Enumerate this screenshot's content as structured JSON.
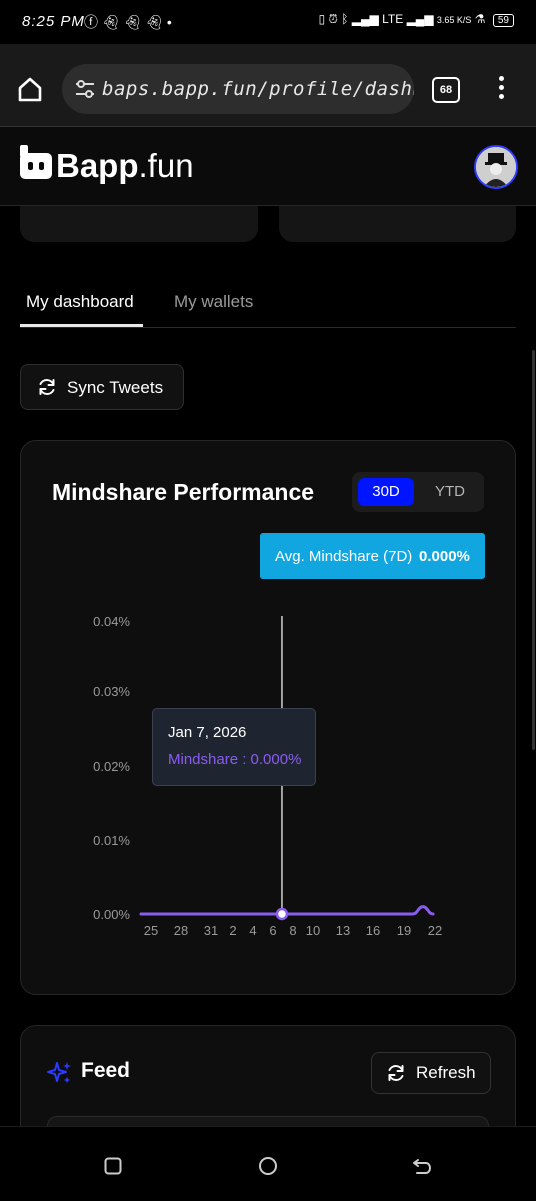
{
  "status_bar": {
    "time": "8:25 PM",
    "left_icons": [
      "facebook-icon",
      "snapchat-icon",
      "snapchat-icon",
      "snapchat-icon",
      "dot-icon"
    ],
    "network": "LTE",
    "speed": "3.65 K/S",
    "battery": "59"
  },
  "browser": {
    "url": "baps.bapp.fun/profile/dashboard",
    "tab_count": "68"
  },
  "site": {
    "logo_bold": "Bapp",
    "logo_rest": ".fun"
  },
  "tabs": [
    {
      "label": "My dashboard",
      "active": true
    },
    {
      "label": "My wallets",
      "active": false
    }
  ],
  "sync_button": {
    "label": "Sync Tweets"
  },
  "mindshare": {
    "title": "Mindshare Performance",
    "range_options": [
      "30D",
      "YTD"
    ],
    "selected_range": "30D",
    "avg_label": "Avg. Mindshare (7D)",
    "avg_value": "0.000%",
    "tooltip": {
      "date": "Jan 7, 2026",
      "text": "Mindshare : 0.000%"
    }
  },
  "chart_data": {
    "type": "line",
    "y_ticks": [
      "0.04%",
      "0.03%",
      "0.02%",
      "0.01%",
      "0.00%"
    ],
    "ylim": [
      0,
      0.04
    ],
    "x_tick_labels": [
      "25",
      "28",
      "31",
      "2",
      "4",
      "6",
      "8",
      "10",
      "13",
      "16",
      "19",
      "22"
    ],
    "series": [
      {
        "color": "#8a5cf0",
        "x": [
          "Dec 24",
          "Dec 25",
          "Dec 26",
          "Dec 27",
          "Dec 28",
          "Dec 29",
          "Dec 30",
          "Dec 31",
          "Jan 1",
          "Jan 2",
          "Jan 3",
          "Jan 4",
          "Jan 5",
          "Jan 6",
          "Jan 7",
          "Jan 8",
          "Jan 9",
          "Jan 10",
          "Jan 11",
          "Jan 12",
          "Jan 13",
          "Jan 14",
          "Jan 15",
          "Jan 16",
          "Jan 17",
          "Jan 18",
          "Jan 19",
          "Jan 20",
          "Jan 21",
          "Jan 22"
        ],
        "values": [
          0,
          0,
          0,
          0,
          0,
          0,
          0,
          0,
          0,
          0,
          0,
          0,
          0,
          0,
          0,
          0,
          0,
          0,
          0,
          0,
          0,
          0,
          0,
          0,
          0,
          0,
          0,
          0,
          0.001,
          0
        ]
      }
    ],
    "highlight_index": 14,
    "grid": false
  },
  "feed": {
    "title": "Feed",
    "refresh_label": "Refresh"
  },
  "nav": [
    "recents-button",
    "home-button",
    "back-button"
  ]
}
